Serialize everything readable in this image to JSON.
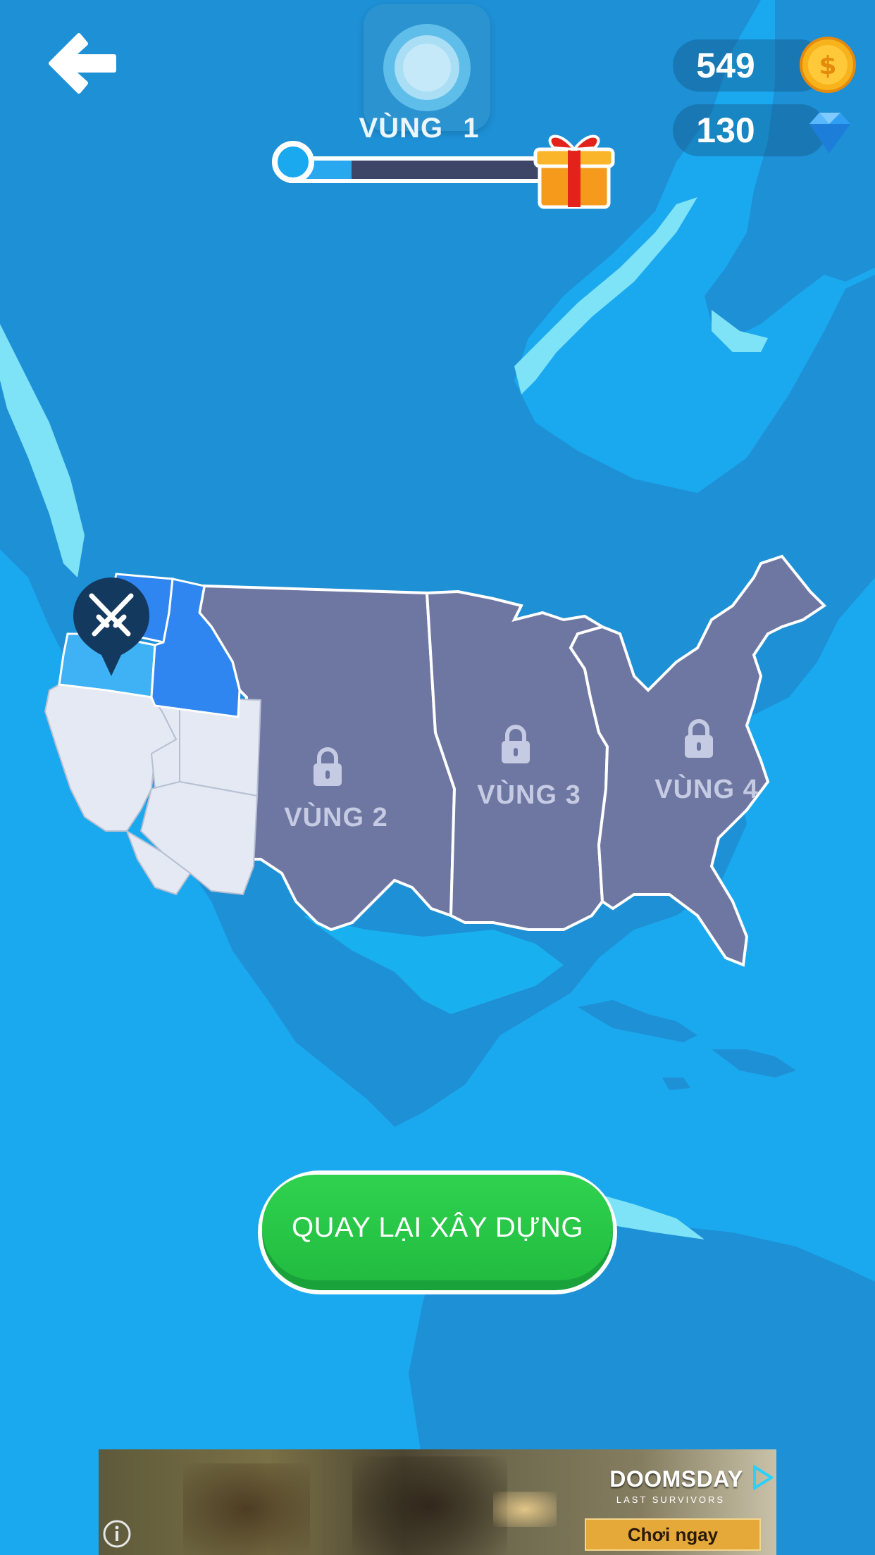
{
  "header": {
    "zone_word": "VÙNG",
    "zone_number": "1",
    "progress": 0.24
  },
  "currency": {
    "coins": "549",
    "gems": "130"
  },
  "map": {
    "zones": [
      {
        "label": "VÙNG 2",
        "locked": true
      },
      {
        "label": "VÙNG 3",
        "locked": true
      },
      {
        "label": "VÙNG 4",
        "locked": true
      }
    ]
  },
  "cta": {
    "label": "QUAY LẠI XÂY DỰNG"
  },
  "ad": {
    "title": "DOOMSDAY",
    "subtitle": "LAST SURVIVORS",
    "cta_label": "Chơi ngay"
  },
  "icons": {
    "back": "back-arrow-icon",
    "gift": "gift-icon",
    "coin": "coin-icon",
    "gem": "gem-icon",
    "lock": "lock-icon",
    "battle": "crossed-swords-icon",
    "info": "info-icon"
  },
  "colors": {
    "ocean": "#1aa9ef",
    "land": "#1e90d6",
    "locked_zone": "#6e76a2",
    "unlocked_state": "#e4e9f3",
    "active_state_light": "#3fb2f5",
    "active_state_dark": "#2f86f0",
    "cta_green": "#2bc948",
    "coin_gold": "#f7b21c",
    "gem_blue": "#2f9ef3"
  }
}
